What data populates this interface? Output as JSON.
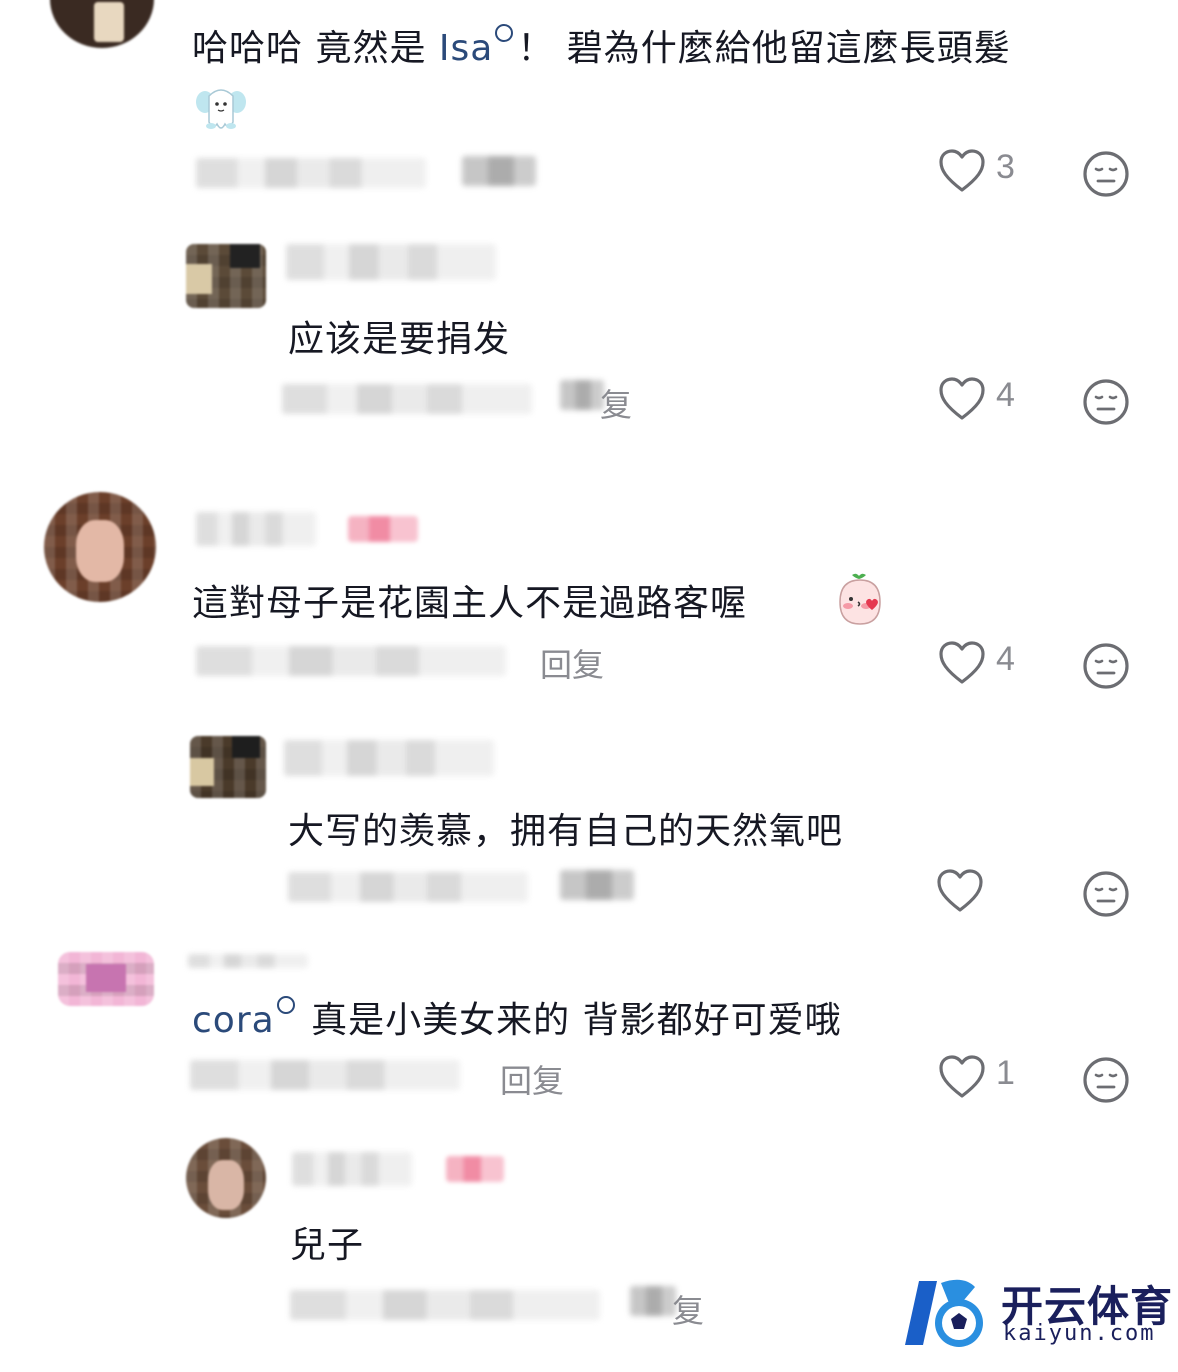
{
  "comments": [
    {
      "id": "c1",
      "mention": "Isa",
      "text": "哈哈哈 竟然是 ",
      "text_after": "！ 碧為什麼給他留這麼長頭髮",
      "likes": "3",
      "emoji": "sticker-ghost"
    },
    {
      "id": "r1",
      "text": "应该是要捐发",
      "reply_label": "复",
      "likes": "4"
    },
    {
      "id": "c2",
      "text": "這對母子是花園主人不是過路客喔",
      "reply_label": "回复",
      "likes": "4",
      "emoji": "sticker-blush-kiss"
    },
    {
      "id": "r2",
      "text": "大写的羡慕，拥有自己的天然氧吧",
      "likes": ""
    },
    {
      "id": "c3",
      "mention": "cora",
      "text": " 真是小美女来的 背影都好可爱哦",
      "reply_label": "回复",
      "likes": "1"
    },
    {
      "id": "r3",
      "text": "兒子",
      "reply_label": "复",
      "likes": ""
    }
  ],
  "watermark": {
    "name": "开云体育",
    "url": "kaiyun.com"
  },
  "colors": {
    "text": "#161823",
    "meta": "#8a8b91",
    "mention": "#2b4a7a",
    "logo": "#1a1f5c",
    "logo_accent": "#2a8fe0"
  },
  "icons": {
    "like": "heart-outline-icon",
    "dislike": "neutral-face-icon"
  }
}
